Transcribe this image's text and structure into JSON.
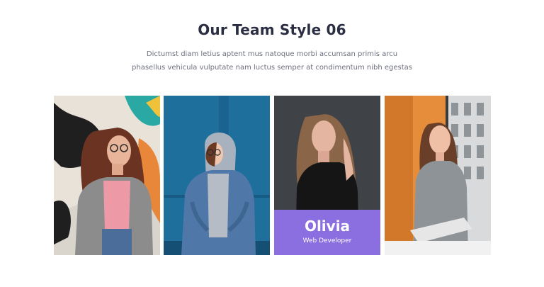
{
  "section": {
    "title": "Our Team Style 06",
    "description": "Dictumst diam letius aptent mus natoque morbi accumsan primis arcu phasellus vehicula vulputate nam luctus semper at condimentum nibh egestas"
  },
  "team": {
    "active_member": {
      "name": "Olivia",
      "role": "Web Developer",
      "overlay_color": "#8b6ee0"
    }
  }
}
